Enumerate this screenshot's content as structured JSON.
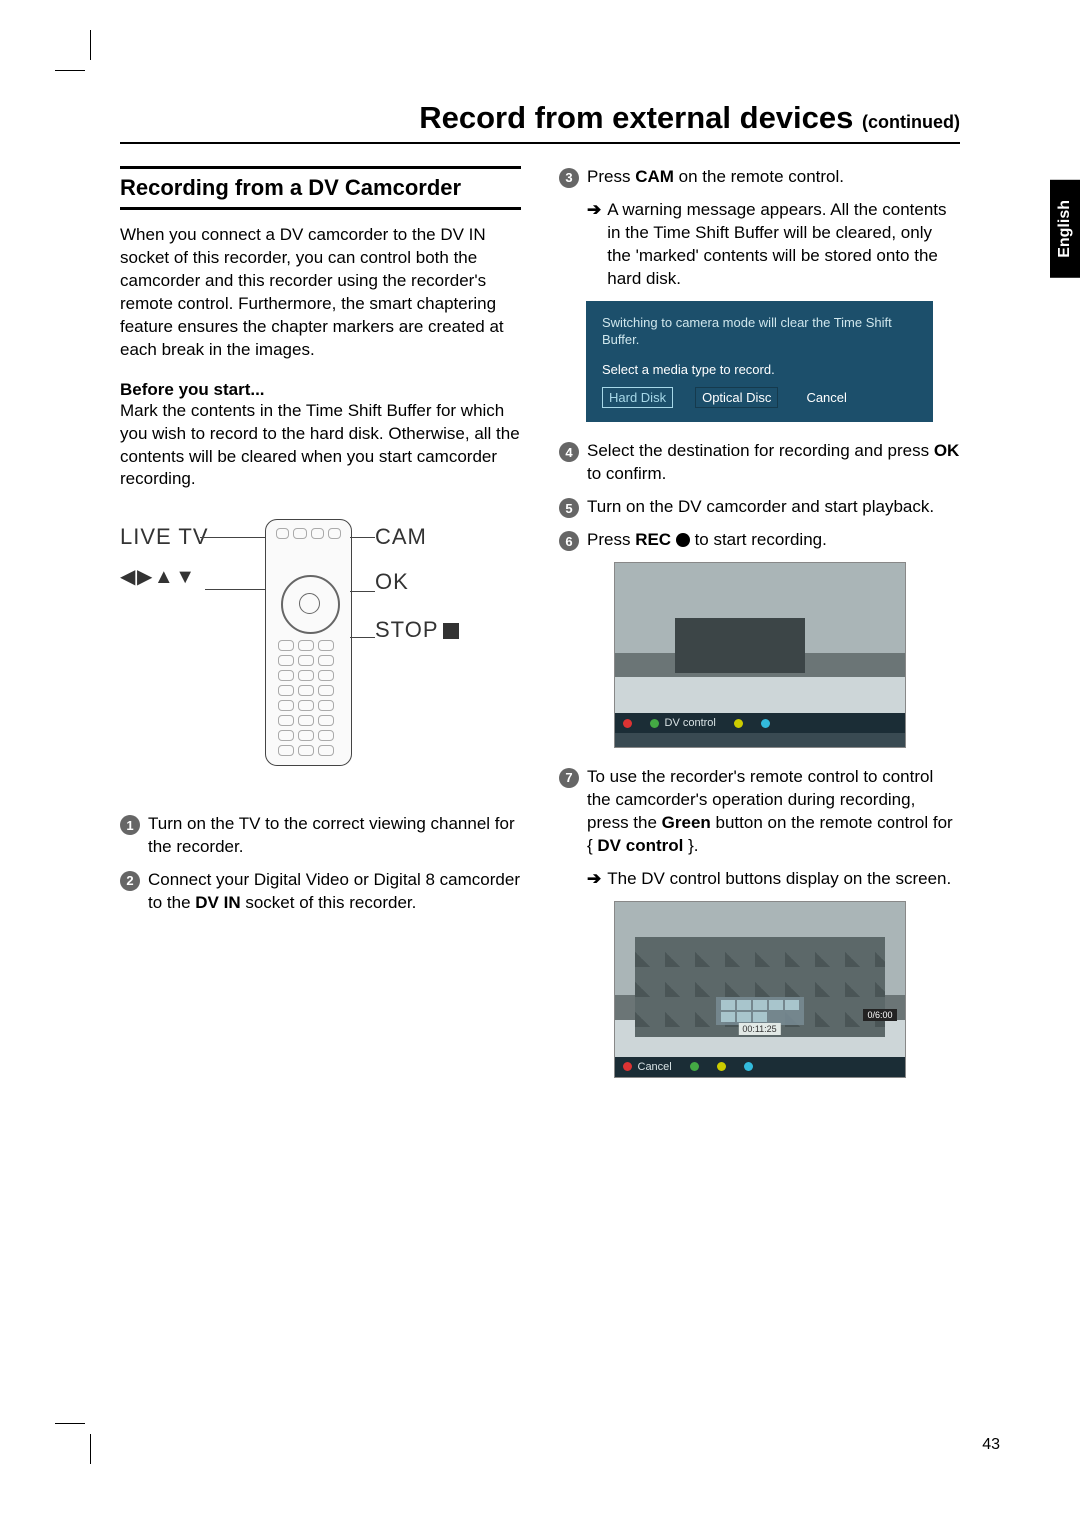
{
  "title_main": "Record from external devices",
  "title_cont": "(continued)",
  "lang_tab": "English",
  "page_number": "43",
  "left": {
    "section_heading": "Recording from a DV Camcorder",
    "intro": "When you connect a DV camcorder to the DV IN socket of this recorder, you can control both the camcorder and this recorder using the recorder's remote control. Furthermore, the smart chaptering feature ensures the chapter markers are created at each break in the images.",
    "before_head": "Before you start...",
    "before_body": "Mark the contents in the Time Shift Buffer for which you wish to record to the hard disk. Otherwise, all the contents will be cleared when you start camcorder recording.",
    "remote_labels": {
      "live_tv": "LIVE TV",
      "cam": "CAM",
      "ok": "OK",
      "stop": "STOP",
      "arrows": "◀ ▶ ▲ ▼"
    },
    "step1": "Turn on the TV to the correct viewing channel for the recorder.",
    "step2_a": "Connect your Digital Video or Digital 8 camcorder to the ",
    "step2_b": "DV IN",
    "step2_c": " socket of this recorder."
  },
  "right": {
    "step3_a": "Press ",
    "step3_b": "CAM",
    "step3_c": " on the remote control.",
    "step3_sub": "A warning message appears. All the contents in the Time Shift Buffer will be cleared, only the 'marked' contents will be stored onto the hard disk.",
    "dialog": {
      "message": "Switching to camera mode will clear the Time Shift Buffer.",
      "prompt": "Select a media type to record.",
      "btn_hard_disk": "Hard Disk",
      "btn_optical": "Optical Disc",
      "btn_cancel": "Cancel"
    },
    "step4_a": "Select the destination for recording and press ",
    "step4_b": "OK",
    "step4_c": " to confirm.",
    "step5": "Turn on the DV camcorder and start playback.",
    "step6_a": "Press ",
    "step6_b": "REC",
    "step6_c": " to start recording.",
    "shot1_label": "DV control",
    "step7_a": "To use the recorder's remote control to control the camcorder's operation during recording, press the ",
    "step7_b": "Green",
    "step7_c": " button on the remote control for { ",
    "step7_d": "DV control",
    "step7_e": " }.",
    "step7_sub": "The DV control buttons display on the screen.",
    "shot2": {
      "cancel": "Cancel",
      "time": "00:11:25",
      "rchip": "0/6:00"
    }
  }
}
